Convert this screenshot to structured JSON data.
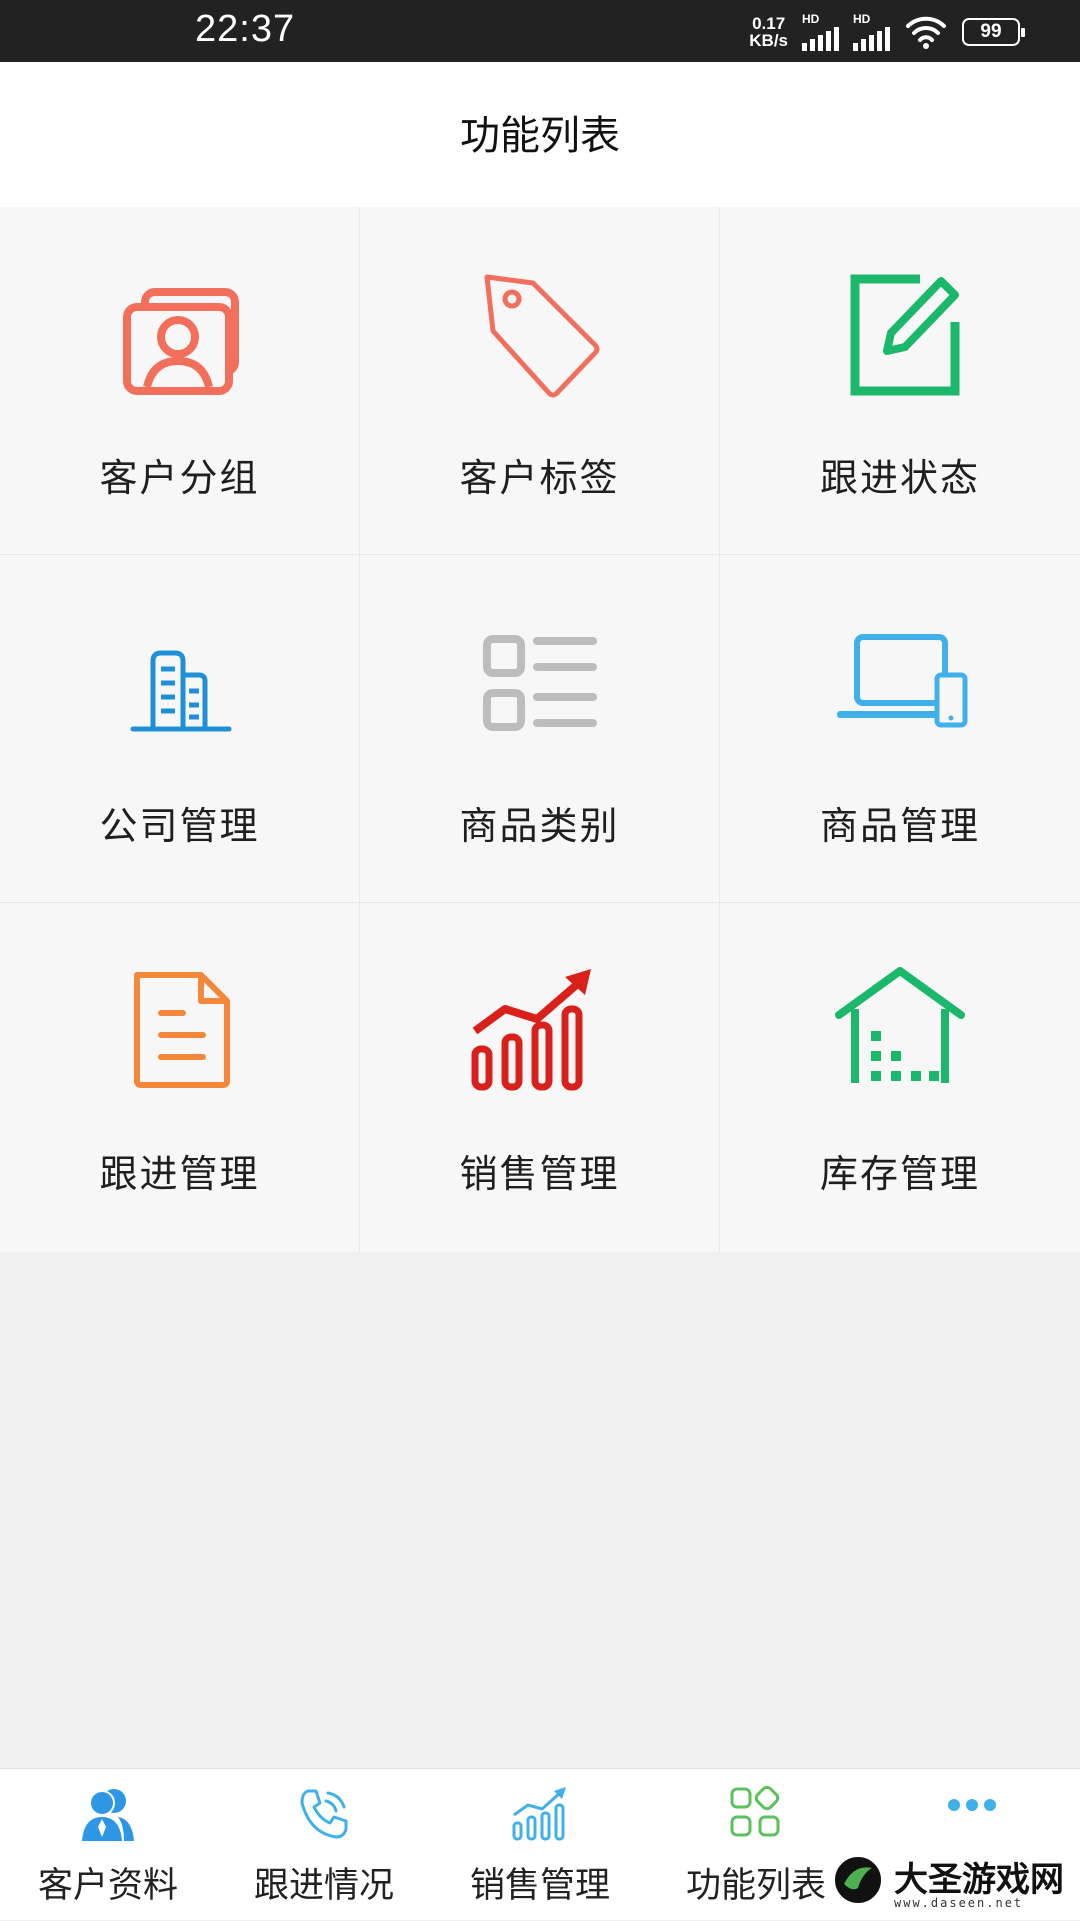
{
  "status_bar": {
    "time": "22:37",
    "net_speed_value": "0.17",
    "net_speed_unit": "KB/s",
    "sim1_label": "HD",
    "sim2_label": "HD",
    "battery": "99"
  },
  "header": {
    "title": "功能列表"
  },
  "functions": [
    {
      "label": "客户分组",
      "icon": "contact-card-icon",
      "color": "#f26f5c"
    },
    {
      "label": "客户标签",
      "icon": "tag-icon",
      "color": "#f26f5c"
    },
    {
      "label": "跟进状态",
      "icon": "edit-icon",
      "color": "#1bb76b"
    },
    {
      "label": "公司管理",
      "icon": "building-icon",
      "color": "#1f8fd6"
    },
    {
      "label": "商品类别",
      "icon": "list-icon",
      "color": "#bdbdbd"
    },
    {
      "label": "商品管理",
      "icon": "laptop-icon",
      "color": "#3fb0ea"
    },
    {
      "label": "跟进管理",
      "icon": "document-icon",
      "color": "#f5873b"
    },
    {
      "label": "销售管理",
      "icon": "sales-chart-icon",
      "color": "#d9201a"
    },
    {
      "label": "库存管理",
      "icon": "warehouse-icon",
      "color": "#1bb76b"
    }
  ],
  "tabbar": {
    "tabs": [
      {
        "label": "客户资料",
        "icon": "customers-icon",
        "color": "#2d97e6"
      },
      {
        "label": "跟进情况",
        "icon": "phone-icon",
        "color": "#3fb0ea"
      },
      {
        "label": "销售管理",
        "icon": "bar-chart-icon",
        "color": "#3fb0ea"
      },
      {
        "label": "功能列表",
        "icon": "grid-icon",
        "color": "#5cc05c"
      },
      {
        "label": "",
        "icon": "more-icon",
        "color": "#3fb0ea"
      }
    ]
  },
  "watermark": {
    "name": "大圣游戏网",
    "url": "www.daseen.net"
  }
}
